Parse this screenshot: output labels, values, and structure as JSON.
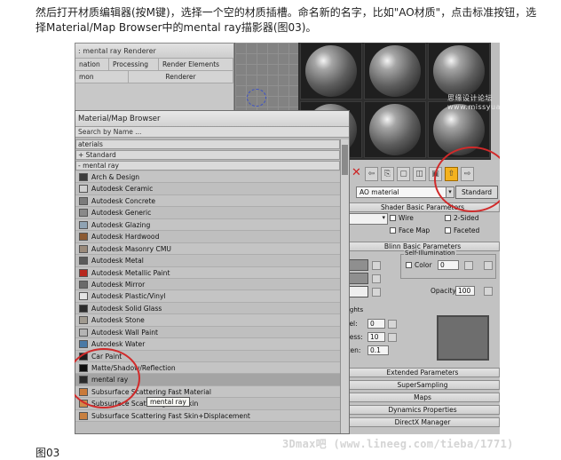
{
  "article": {
    "intro": "然后打开材质编辑器(按M键)，选择一个空的材质插槽。命名新的名字，比如\"AO材质\"，点击标准按钮，选择Material/Map Browser中的mental ray描影器(图03)。",
    "figure_caption": "图03",
    "watermark_bottom": "3Dmax吧 (www.lineeg.com/tieba/1771)",
    "watermark_top": "思缘设计论坛 www.missyuan.com"
  },
  "renderer_window": {
    "title": ": mental ray Renderer",
    "tabs_row1": [
      "nation",
      "Processing",
      "Render Elements"
    ],
    "tabs_row2": [
      "mon",
      "Renderer"
    ]
  },
  "material_editor": {
    "material_name": "AO material",
    "type_button": "Standard",
    "rollouts": {
      "shader_basic": "Shader Basic Parameters",
      "blinn_basic": "Blinn Basic Parameters",
      "extended": "Extended Parameters",
      "supersampling": "SuperSampling",
      "maps": "Maps",
      "dynamics": "Dynamics Properties",
      "directx": "DirectX Manager"
    },
    "checkboxes": {
      "wire": "Wire",
      "two_sided": "2-Sided",
      "face_map": "Face Map",
      "faceted": "Faceted"
    },
    "self_illumination": {
      "group": "Self-Illumination",
      "color_label": "Color",
      "color_value": "0"
    },
    "opacity": {
      "label": "Opacity:",
      "value": "100"
    },
    "highlights": {
      "group": "lights",
      "level_label": "vel:",
      "level_value": "0",
      "gloss_label": "ness:",
      "gloss_value": "10",
      "soften_label": "ften:",
      "soften_value": "0.1"
    }
  },
  "browser": {
    "title": "Material/Map Browser",
    "search_placeholder": "Search by Name ...",
    "sections": {
      "materials": "aterials",
      "standard": "+ Standard",
      "mental_ray": "- mental ray"
    },
    "items": [
      {
        "label": "Arch & Design",
        "color": "#3b3b3b"
      },
      {
        "label": "Autodesk Ceramic",
        "color": "#cfcfcf"
      },
      {
        "label": "Autodesk Concrete",
        "color": "#7b7b7b"
      },
      {
        "label": "Autodesk Generic",
        "color": "#8a8a8a"
      },
      {
        "label": "Autodesk Glazing",
        "color": "#8fa3b4"
      },
      {
        "label": "Autodesk Hardwood",
        "color": "#8c5a32"
      },
      {
        "label": "Autodesk Masonry CMU",
        "color": "#9a8a7a"
      },
      {
        "label": "Autodesk Metal",
        "color": "#5a5a5a"
      },
      {
        "label": "Autodesk Metallic Paint",
        "color": "#b8281e"
      },
      {
        "label": "Autodesk Mirror",
        "color": "#6a6a6a"
      },
      {
        "label": "Autodesk Plastic/Vinyl",
        "color": "#e4e4e4"
      },
      {
        "label": "Autodesk Solid Glass",
        "color": "#2c2c2c"
      },
      {
        "label": "Autodesk Stone",
        "color": "#a09a90"
      },
      {
        "label": "Autodesk Wall Paint",
        "color": "#b4b4b4"
      },
      {
        "label": "Autodesk Water",
        "color": "#4a7aa6"
      },
      {
        "label": "Car Paint",
        "color": "#1e1e1e"
      },
      {
        "label": "Matte/Shadow/Reflection",
        "color": "#0e0e0e"
      },
      {
        "label": "mental ray",
        "color": "#2a2a2a"
      },
      {
        "label": "Subsurface Scattering Fast Material",
        "color": "#c97a3a"
      },
      {
        "label": "Subsurface Scattering Fast Skin",
        "color": "#d08a4a"
      },
      {
        "label": "Subsurface Scattering Fast Skin+Displacement",
        "color": "#c98040"
      }
    ],
    "tooltip": "mental ray"
  },
  "colors": {
    "annotation_circle": "#d12a2a",
    "highlight_button": "#f4b21e"
  }
}
